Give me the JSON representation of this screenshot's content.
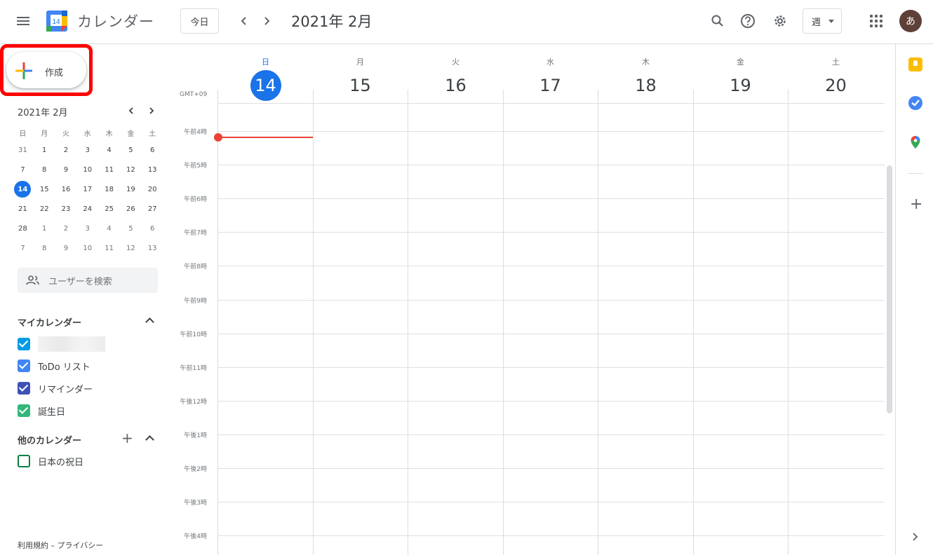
{
  "header": {
    "app_title": "カレンダー",
    "logo_date": "14",
    "today_button": "今日",
    "month_title": "2021年 2月",
    "view_selector": "週",
    "avatar_initial": "あ",
    "icons": [
      "menu-icon",
      "prev-icon",
      "next-icon",
      "search-icon",
      "help-icon",
      "settings-icon",
      "apps-icon"
    ]
  },
  "sidebar": {
    "create_label": "作成",
    "mini_title": "2021年 2月",
    "weekdays": [
      "日",
      "月",
      "火",
      "水",
      "木",
      "金",
      "土"
    ],
    "weeks": [
      [
        "31",
        "1",
        "2",
        "3",
        "4",
        "5",
        "6"
      ],
      [
        "7",
        "8",
        "9",
        "10",
        "11",
        "12",
        "13"
      ],
      [
        "14",
        "15",
        "16",
        "17",
        "18",
        "19",
        "20"
      ],
      [
        "21",
        "22",
        "23",
        "24",
        "25",
        "26",
        "27"
      ],
      [
        "28",
        "1",
        "2",
        "3",
        "4",
        "5",
        "6"
      ],
      [
        "7",
        "8",
        "9",
        "10",
        "11",
        "12",
        "13"
      ]
    ],
    "search_placeholder": "ユーザーを検索",
    "my_calendars_title": "マイカレンダー",
    "my_calendars": [
      {
        "label": "",
        "color": "#039be5"
      },
      {
        "label": "ToDo リスト",
        "color": "#4285f4"
      },
      {
        "label": "リマインダー",
        "color": "#3f51b5"
      },
      {
        "label": "誕生日",
        "color": "#33b679"
      }
    ],
    "other_calendars_title": "他のカレンダー",
    "other_calendars": [
      {
        "label": "日本の祝日",
        "color": "#0b8043"
      }
    ],
    "footer": "利用規約 – プライバシー"
  },
  "week": {
    "timezone": "GMT+09",
    "days": [
      {
        "dow": "日",
        "num": "14"
      },
      {
        "dow": "月",
        "num": "15"
      },
      {
        "dow": "火",
        "num": "16"
      },
      {
        "dow": "水",
        "num": "17"
      },
      {
        "dow": "木",
        "num": "18"
      },
      {
        "dow": "金",
        "num": "19"
      },
      {
        "dow": "土",
        "num": "20"
      }
    ],
    "hours": [
      "午前4時",
      "午前5時",
      "午前6時",
      "午前7時",
      "午前8時",
      "午前9時",
      "午前10時",
      "午前11時",
      "午後12時",
      "午後1時",
      "午後2時",
      "午後3時",
      "午後4時"
    ]
  },
  "colors": {
    "accent": "#1a73e8",
    "now_line": "#ea4335",
    "highlight_frame": "#ff0000"
  }
}
